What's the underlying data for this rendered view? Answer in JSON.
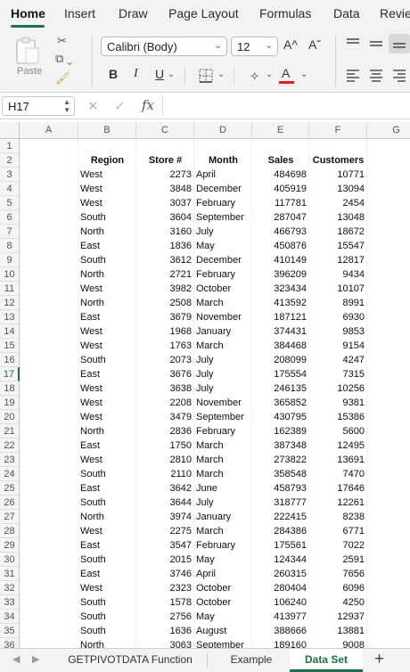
{
  "ribbon_tabs": [
    "Home",
    "Insert",
    "Draw",
    "Page Layout",
    "Formulas",
    "Data",
    "Revie"
  ],
  "ribbon": {
    "paste_label": "Paste",
    "font_name": "Calibri (Body)",
    "font_size": "12",
    "grow_font": "A^",
    "shrink_font": "Aˇ",
    "bold": "B",
    "italic": "I",
    "underline": "U",
    "font_color_letter": "A",
    "icons": [
      "clipboard-icon",
      "scissors-icon",
      "copy-icon",
      "format-painter-icon",
      "borders-icon",
      "fill-color-icon",
      "font-color-icon",
      "align-top-icon",
      "align-middle-icon",
      "align-bottom-icon",
      "align-left-icon",
      "align-center-icon",
      "align-right-icon"
    ]
  },
  "formula_bar": {
    "name_box": "H17",
    "cancel": "✕",
    "enter": "✓",
    "fx": "fx",
    "value": ""
  },
  "columns": [
    "A",
    "B",
    "C",
    "D",
    "E",
    "F",
    "G"
  ],
  "active_row": 17,
  "table": {
    "headers": [
      "Region",
      "Store #",
      "Month",
      "Sales",
      "Customers"
    ],
    "rows": [
      [
        "West",
        "2273",
        "April",
        "484698",
        "10771"
      ],
      [
        "West",
        "3848",
        "December",
        "405919",
        "13094"
      ],
      [
        "West",
        "3037",
        "February",
        "117781",
        "2454"
      ],
      [
        "South",
        "3604",
        "September",
        "287047",
        "13048"
      ],
      [
        "North",
        "3160",
        "July",
        "466793",
        "18672"
      ],
      [
        "East",
        "1836",
        "May",
        "450876",
        "15547"
      ],
      [
        "South",
        "3612",
        "December",
        "410149",
        "12817"
      ],
      [
        "North",
        "2721",
        "February",
        "396209",
        "9434"
      ],
      [
        "West",
        "3982",
        "October",
        "323434",
        "10107"
      ],
      [
        "North",
        "2508",
        "March",
        "413592",
        "8991"
      ],
      [
        "East",
        "3679",
        "November",
        "187121",
        "6930"
      ],
      [
        "West",
        "1968",
        "January",
        "374431",
        "9853"
      ],
      [
        "West",
        "1763",
        "March",
        "384468",
        "9154"
      ],
      [
        "South",
        "2073",
        "July",
        "208099",
        "4247"
      ],
      [
        "East",
        "3676",
        "July",
        "175554",
        "7315"
      ],
      [
        "West",
        "3638",
        "July",
        "246135",
        "10256"
      ],
      [
        "West",
        "2208",
        "November",
        "365852",
        "9381"
      ],
      [
        "West",
        "3479",
        "September",
        "430795",
        "15386"
      ],
      [
        "North",
        "2836",
        "February",
        "162389",
        "5600"
      ],
      [
        "East",
        "1750",
        "March",
        "387348",
        "12495"
      ],
      [
        "West",
        "2810",
        "March",
        "273822",
        "13691"
      ],
      [
        "South",
        "2110",
        "March",
        "358548",
        "7470"
      ],
      [
        "East",
        "3642",
        "June",
        "458793",
        "17646"
      ],
      [
        "South",
        "3644",
        "July",
        "318777",
        "12261"
      ],
      [
        "North",
        "3974",
        "January",
        "222415",
        "8238"
      ],
      [
        "West",
        "2275",
        "March",
        "284386",
        "6771"
      ],
      [
        "East",
        "3547",
        "February",
        "175561",
        "7022"
      ],
      [
        "South",
        "2015",
        "May",
        "124344",
        "2591"
      ],
      [
        "East",
        "3746",
        "April",
        "260315",
        "7656"
      ],
      [
        "West",
        "2323",
        "October",
        "280404",
        "6096"
      ],
      [
        "South",
        "1578",
        "October",
        "106240",
        "4250"
      ],
      [
        "South",
        "2756",
        "May",
        "413977",
        "12937"
      ],
      [
        "South",
        "1636",
        "August",
        "388666",
        "13881"
      ],
      [
        "North",
        "3063",
        "September",
        "189160",
        "9008"
      ]
    ]
  },
  "row_numbers": [
    "1",
    "2",
    "3",
    "4",
    "5",
    "6",
    "7",
    "8",
    "9",
    "10",
    "11",
    "12",
    "13",
    "14",
    "15",
    "16",
    "17",
    "18",
    "19",
    "20",
    "21",
    "22",
    "23",
    "24",
    "25",
    "26",
    "27",
    "28",
    "29",
    "30",
    "31",
    "32",
    "33",
    "34",
    "35",
    "36"
  ],
  "sheet_tabs": [
    "GETPIVOTDATA Function",
    "Example",
    "Data Set"
  ],
  "active_sheet": "Data Set",
  "colors": {
    "accent": "#1e7145",
    "font_color_bar": "#e02020"
  }
}
